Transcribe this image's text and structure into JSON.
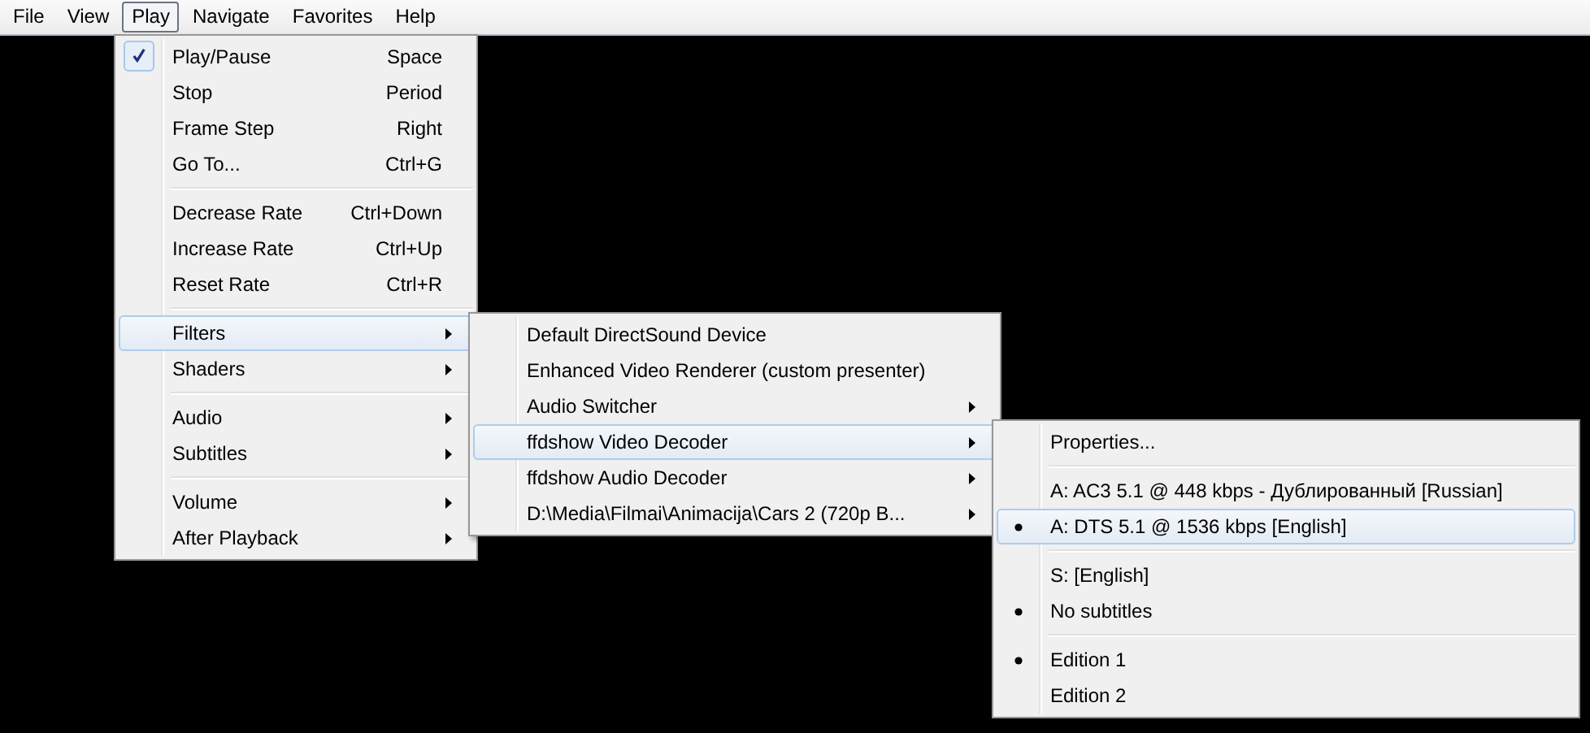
{
  "menubar": [
    {
      "label": "File",
      "selected": false
    },
    {
      "label": "View",
      "selected": false
    },
    {
      "label": "Play",
      "selected": true
    },
    {
      "label": "Navigate",
      "selected": false
    },
    {
      "label": "Favorites",
      "selected": false
    },
    {
      "label": "Help",
      "selected": false
    }
  ],
  "menus": [
    {
      "kind": "check",
      "items": [
        {
          "kind": "command",
          "label": "Play/Pause",
          "shortcut": "Space",
          "checked": true,
          "selected": false
        },
        {
          "kind": "command",
          "label": "Stop",
          "shortcut": "Period",
          "checked": false,
          "selected": false
        },
        {
          "kind": "command",
          "label": "Frame Step",
          "shortcut": "Right",
          "checked": false,
          "selected": false
        },
        {
          "kind": "command",
          "label": "Go To...",
          "shortcut": "Ctrl+G",
          "checked": false,
          "selected": false
        },
        {
          "kind": "separator"
        },
        {
          "kind": "command",
          "label": "Decrease Rate",
          "shortcut": "Ctrl+Down",
          "checked": false,
          "selected": false
        },
        {
          "kind": "command",
          "label": "Increase Rate",
          "shortcut": "Ctrl+Up",
          "checked": false,
          "selected": false
        },
        {
          "kind": "command",
          "label": "Reset Rate",
          "shortcut": "Ctrl+R",
          "checked": false,
          "selected": false
        },
        {
          "kind": "separator"
        },
        {
          "kind": "submenu",
          "label": "Filters",
          "checked": false,
          "selected": true
        },
        {
          "kind": "submenu",
          "label": "Shaders",
          "checked": false,
          "selected": false
        },
        {
          "kind": "separator"
        },
        {
          "kind": "submenu",
          "label": "Audio",
          "checked": false,
          "selected": false
        },
        {
          "kind": "submenu",
          "label": "Subtitles",
          "checked": false,
          "selected": false
        },
        {
          "kind": "separator"
        },
        {
          "kind": "submenu",
          "label": "Volume",
          "checked": false,
          "selected": false
        },
        {
          "kind": "submenu",
          "label": "After Playback",
          "checked": false,
          "selected": false
        }
      ]
    },
    {
      "items": [
        {
          "kind": "command",
          "label": "Default DirectSound Device",
          "checked": false,
          "selected": false
        },
        {
          "kind": "command",
          "label": "Enhanced Video Renderer (custom presenter)",
          "checked": false,
          "selected": false
        },
        {
          "kind": "submenu",
          "label": "Audio Switcher",
          "checked": false,
          "selected": false
        },
        {
          "kind": "submenu",
          "label": "ffdshow Video Decoder",
          "checked": false,
          "selected": true
        },
        {
          "kind": "submenu",
          "label": "ffdshow Audio Decoder",
          "checked": false,
          "selected": false
        },
        {
          "kind": "submenu",
          "label": "D:\\Media\\Filmai\\Animacija\\Cars 2 (720p B...",
          "checked": false,
          "selected": false
        }
      ]
    },
    {
      "kind": "radio",
      "items": [
        {
          "kind": "command",
          "label": "Properties...",
          "checked": false,
          "selected": false
        },
        {
          "kind": "separator"
        },
        {
          "kind": "command",
          "label": "A: AC3 5.1 @ 448 kbps - Дублированный [Russian]",
          "checked": false,
          "selected": false
        },
        {
          "kind": "command",
          "label": "A: DTS 5.1 @ 1536 kbps [English]",
          "checked": true,
          "selected": true
        },
        {
          "kind": "separator"
        },
        {
          "kind": "command",
          "label": "S: [English]",
          "checked": false,
          "selected": false
        },
        {
          "kind": "command",
          "label": "No subtitles",
          "checked": true,
          "selected": false
        },
        {
          "kind": "separator"
        },
        {
          "kind": "command",
          "label": "Edition 1",
          "checked": true,
          "selected": false
        },
        {
          "kind": "command",
          "label": "Edition 2",
          "checked": false,
          "selected": false
        }
      ]
    }
  ]
}
